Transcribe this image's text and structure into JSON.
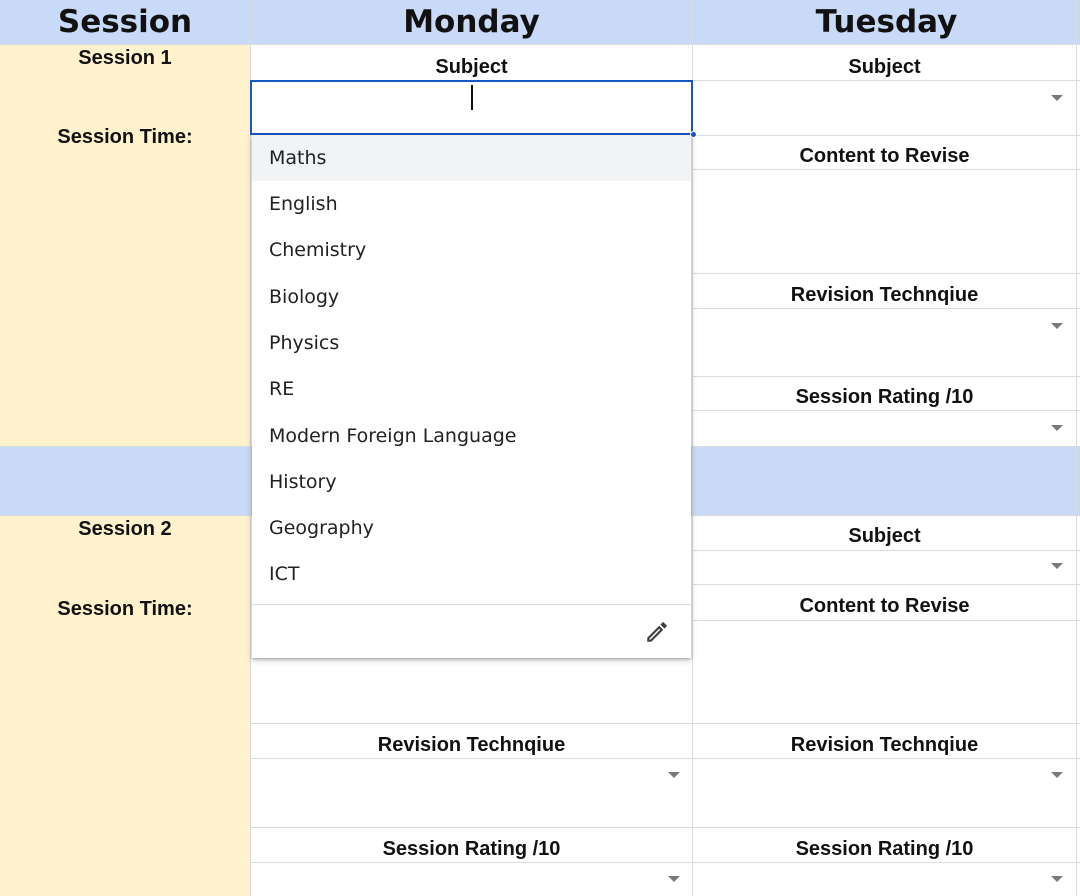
{
  "header": {
    "session_label": "Session",
    "monday_label": "Monday",
    "tuesday_label": "Tuesday"
  },
  "session1": {
    "name": "Session 1",
    "time_label": "Session Time:",
    "monday": {
      "subject_label": "Subject"
    },
    "tuesday": {
      "subject_label": "Subject",
      "content_label": "Content to Revise",
      "technique_label": "Revision Technqiue",
      "rating_label": "Session Rating /10"
    }
  },
  "session2": {
    "name": "Session 2",
    "time_label": "Session Time:",
    "monday": {
      "technique_label": "Revision Technqiue",
      "rating_label": "Session Rating /10"
    },
    "tuesday": {
      "subject_label": "Subject",
      "content_label": "Content to Revise",
      "technique_label": "Revision Technqiue",
      "rating_label": "Session Rating /10"
    }
  },
  "subject_dropdown": {
    "input_value": "",
    "highlighted_index": 0,
    "options": [
      "Maths",
      "English",
      "Chemistry",
      "Biology",
      "Physics",
      "RE",
      "Modern Foreign Language",
      "History",
      "Geography",
      "ICT"
    ],
    "edit_icon": "pencil-icon"
  },
  "colors": {
    "header_bg": "#c9daf8",
    "session_bg": "#fff2cc",
    "accent": "#1a57c4"
  }
}
